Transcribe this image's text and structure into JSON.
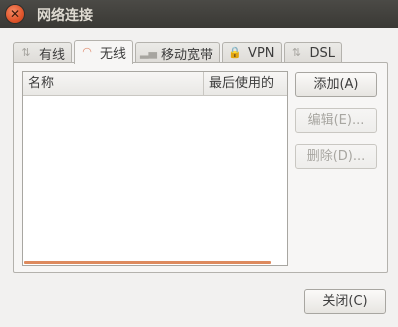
{
  "window": {
    "title": "网络连接",
    "close_glyph": "✕"
  },
  "tabs": [
    {
      "label": "有线",
      "icon": "wired-icon",
      "glyph": "⇅"
    },
    {
      "label": "无线",
      "icon": "wireless-icon",
      "glyph": "◠",
      "active": true
    },
    {
      "label": "移动宽带",
      "icon": "mobile-broadband-icon",
      "glyph": "▂▄"
    },
    {
      "label": "VPN",
      "icon": "lock-icon",
      "glyph": "🔒"
    },
    {
      "label": "DSL",
      "icon": "dsl-icon",
      "glyph": "⇅"
    }
  ],
  "list": {
    "columns": [
      "名称",
      "最后使用的"
    ],
    "rows": []
  },
  "buttons": {
    "add": "添加(A)",
    "edit": "编辑(E)...",
    "delete": "删除(D)...",
    "close": "关闭(C)"
  },
  "colors": {
    "accent": "#dd8a5e",
    "titlebar": "#3c3b37"
  }
}
